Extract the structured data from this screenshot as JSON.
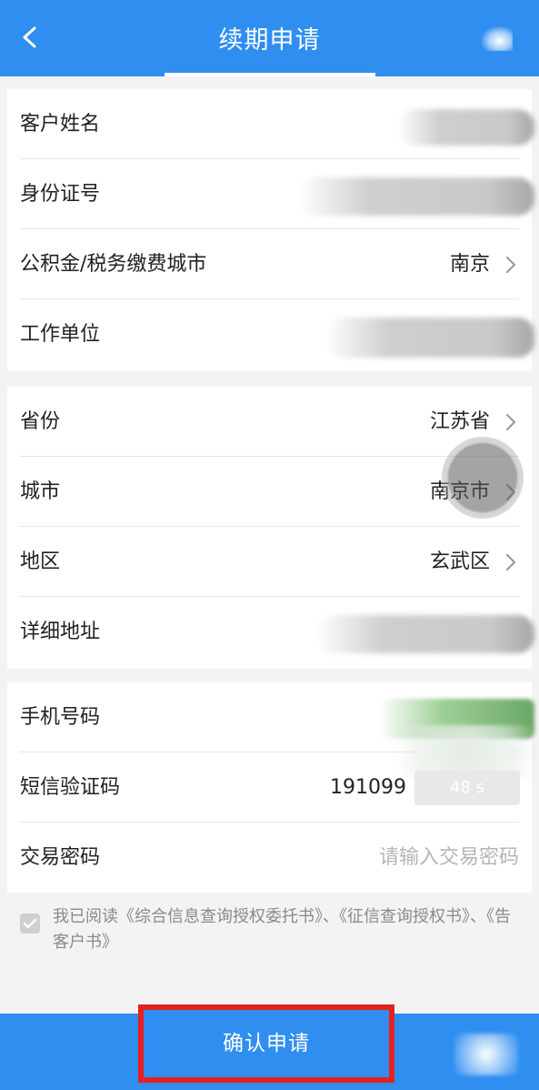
{
  "header": {
    "title": "续期申请"
  },
  "personal": {
    "name_label": "客户姓名",
    "id_label": "身份证号",
    "city_label": "公积金/税务缴费城市",
    "city_value": "南京",
    "employer_label": "工作单位"
  },
  "address": {
    "province_label": "省份",
    "province_value": "江苏省",
    "city_label": "城市",
    "city_value": "南京市",
    "district_label": "地区",
    "district_value": "玄武区",
    "detail_label": "详细地址"
  },
  "verify": {
    "phone_label": "手机号码",
    "sms_label": "短信验证码",
    "sms_value": "191099",
    "countdown": "48 s",
    "password_label": "交易密码",
    "password_placeholder": "请输入交易密码"
  },
  "agreement": {
    "text": "我已阅读《综合信息查询授权委托书》、《征信查询授权书》、《告客户书》"
  },
  "footer": {
    "confirm_label": "确认申请"
  },
  "colors": {
    "primary": "#2f8ef0",
    "highlight_border": "#e62020"
  },
  "icons": [
    "back-arrow-icon",
    "chevron-right-icon",
    "checkbox-icon"
  ]
}
